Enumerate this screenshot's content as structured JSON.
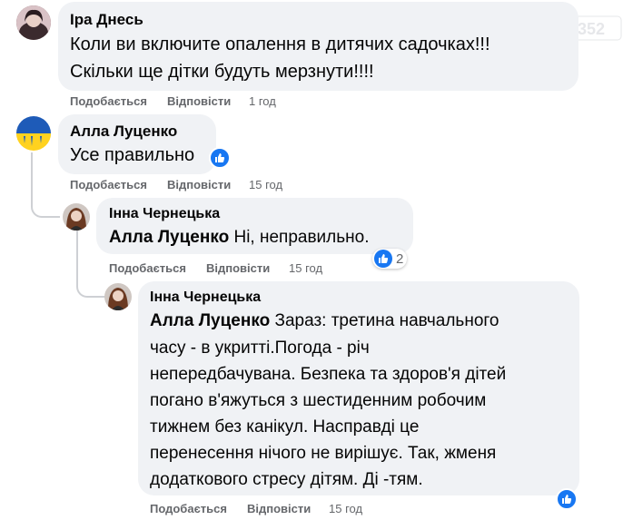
{
  "comments": [
    {
      "author": "Іра Днесь",
      "lines": [
        "Коли ви включите опалення в дитячих садочках!!!",
        "Скільки ще дітки будуть мерзнути!!!!"
      ],
      "like_label": "Подобається",
      "reply_label": "Відповісти",
      "time": "1 год"
    },
    {
      "author": "Алла Луценко",
      "lines": [
        "Усе правильно"
      ],
      "like_label": "Подобається",
      "reply_label": "Відповісти",
      "time": "15 год"
    },
    {
      "author": "Інна Чернецька",
      "mention": "Алла Луценко",
      "text_after_mention": " Ні, неправильно.",
      "like_label": "Подобається",
      "reply_label": "Відповісти",
      "time": "15 год",
      "reaction_count": "2"
    },
    {
      "author": "Інна Чернецька",
      "mention": "Алла Луценко",
      "first_line_rest": " Зараз: третина навчального",
      "lines": [
        "часу - в укритті.Погода - річ",
        "непередбачувана. Безпека та здоров'я дітей",
        "погано в'яжуться з шестиденним робочим",
        "тижнем без канікул. Насправді це",
        "перенесення нічого не вирішує. Так, жменя",
        "додаткового стресу дітям. Ді -тям."
      ],
      "like_label": "Подобається",
      "reply_label": "Відповісти",
      "time": "15 год"
    }
  ],
  "watermark": "0352",
  "colors": {
    "like_blue": "#1877f2",
    "bubble": "#f0f2f5",
    "meta": "#65676b"
  }
}
